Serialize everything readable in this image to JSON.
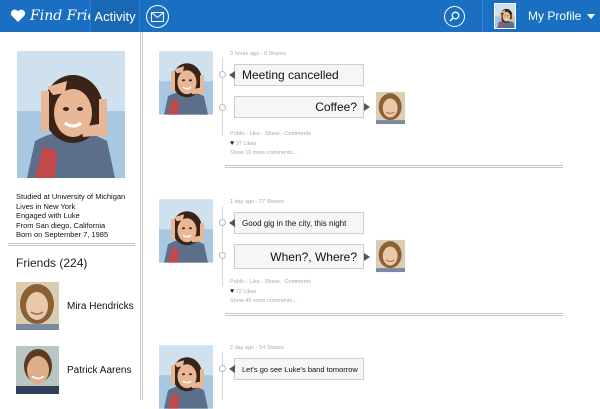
{
  "topbar": {
    "brand": "Find Friends",
    "activity_label": "Activity",
    "profile_label": "My Profile"
  },
  "profile": {
    "bio": [
      "Studied at University of Michigan",
      "Lives in New York",
      "Engaged with Luke",
      "From San diego, California",
      "Born on September 7, 1985"
    ]
  },
  "friends": {
    "title": "Friends (224)",
    "items": [
      {
        "name": "Mira Hendricks"
      },
      {
        "name": "Patrick Aarens"
      }
    ]
  },
  "posts": [
    {
      "meta": "3 hours ago - 0 Shares",
      "message": "Meeting cancelled",
      "reply": "Coffee?",
      "actions": "Public - Like - Share - Comments",
      "likes": "37 Likes",
      "more": "Show 16 more comments..."
    },
    {
      "meta": "1 day ago - 27 Shares",
      "message": "Good gig in the city, this night",
      "reply": "When?, Where?",
      "actions": "Public - Like - Share - Comments",
      "likes": "72 Likes",
      "more": "Show 45 more comments..."
    },
    {
      "meta": "2 day ago - 54 Shares",
      "message": "Let's go see Luke's band tomorrow"
    }
  ],
  "colors": {
    "topbar": "#1b6fc2",
    "accent": "#1968b6"
  }
}
